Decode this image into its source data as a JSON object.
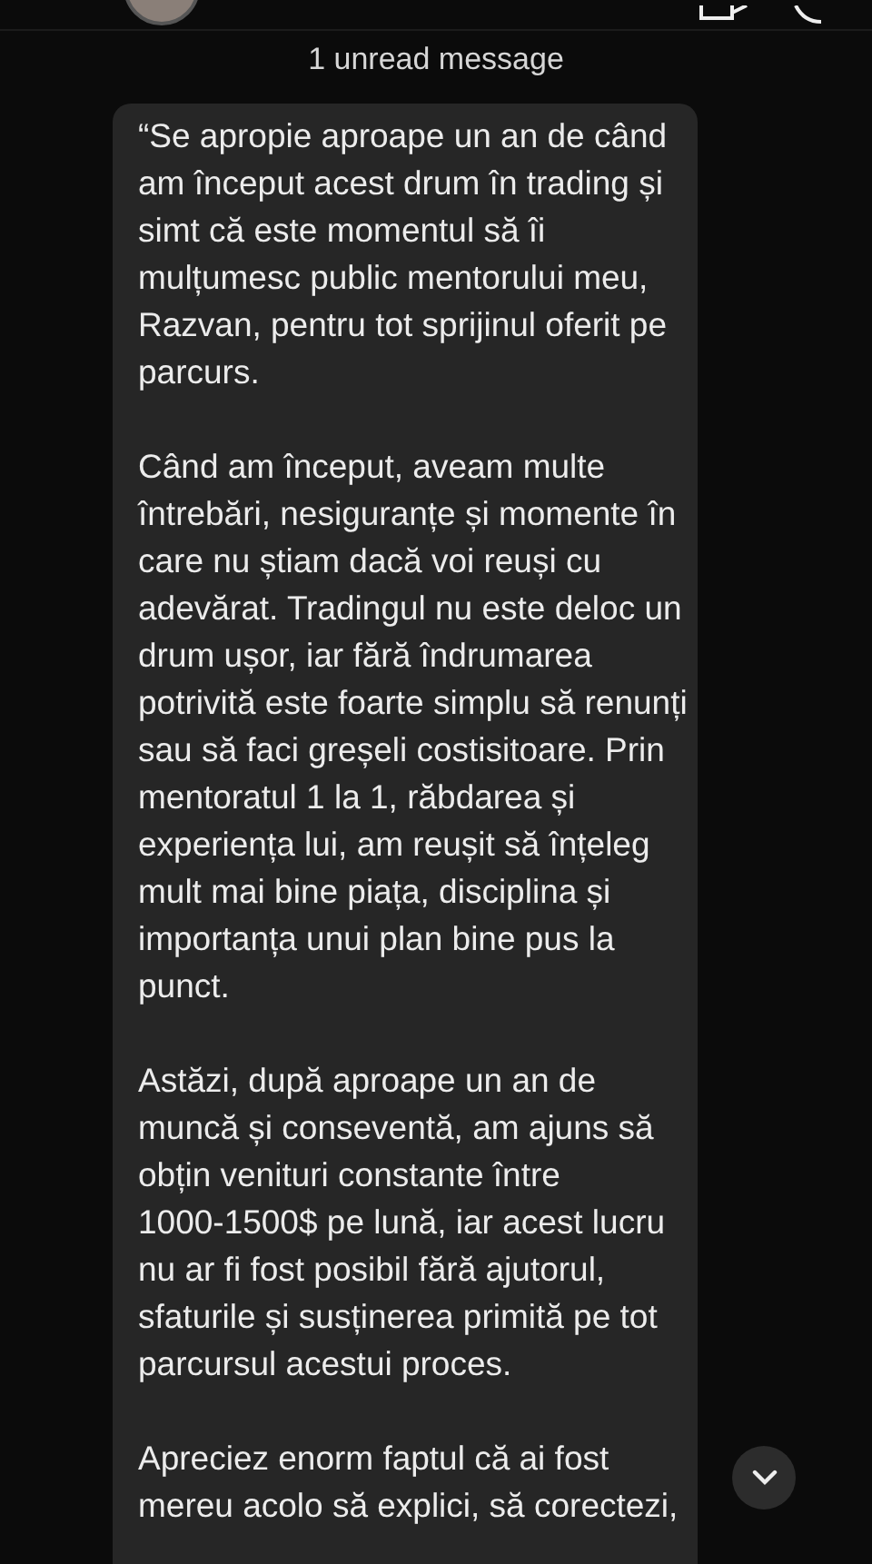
{
  "unread_banner": {
    "label": "1 unread message"
  },
  "message": {
    "paragraphs": [
      {
        "lines": [
          "“Se apropie aproape un an de când",
          "am început acest drum în trading și",
          "simt că este momentul să îi",
          "mulțumesc public mentorului meu,",
          "Razvan, pentru tot sprijinul oferit pe",
          "parcurs."
        ]
      },
      {
        "lines": [
          "Când am început, aveam multe",
          "întrebări, nesiguranțe și momente în",
          "care nu știam dacă voi reuși cu",
          "adevărat. Tradingul nu este deloc un",
          "drum ușor, iar fără îndrumarea",
          "potrivită este foarte simplu să renunți",
          "sau să faci greșeli costisitoare. Prin",
          "mentoratul 1 la 1, răbdarea și",
          "experiența lui, am reușit să înțeleg",
          "mult mai bine piața, disciplina și",
          "importanța unui plan bine pus la",
          "punct."
        ]
      },
      {
        "lines": [
          "Astăzi, după aproape un an de",
          "muncă și conseventă, am ajuns să",
          "obțin venituri constante între",
          "1000-1500$ pe lună, iar acest lucru",
          "nu ar fi fost posibil fără ajutorul,",
          "sfaturile și susținerea primită pe tot",
          "parcursul acestui proces."
        ]
      },
      {
        "lines": [
          "Apreciez enorm faptul că ai fost",
          "mereu acolo să explici, să corectezi,"
        ]
      }
    ]
  }
}
